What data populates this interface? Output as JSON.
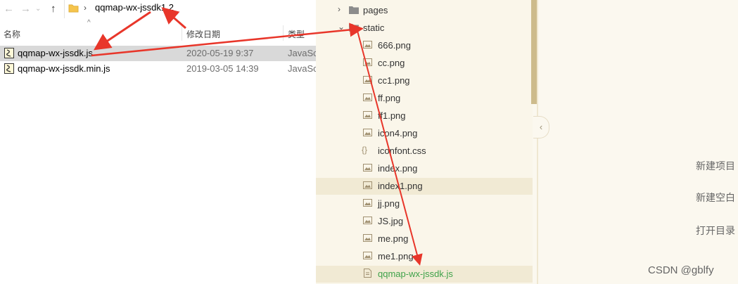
{
  "explorer": {
    "breadcrumb": "qqmap-wx-jssdk1.2",
    "columns": {
      "name": "名称",
      "date": "修改日期",
      "type": "类型"
    },
    "files": [
      {
        "name": "qqmap-wx-jssdk.js",
        "date": "2020-05-19 9:37",
        "type": "JavaScript"
      },
      {
        "name": "qqmap-wx-jssdk.min.js",
        "date": "2019-03-05 14:39",
        "type": "JavaScript"
      }
    ]
  },
  "ide": {
    "tree": [
      {
        "label": "pages",
        "kind": "folder-collapsed"
      },
      {
        "label": "static",
        "kind": "folder-open"
      },
      {
        "label": "666.png",
        "kind": "image"
      },
      {
        "label": "cc.png",
        "kind": "image"
      },
      {
        "label": "cc1.png",
        "kind": "image"
      },
      {
        "label": "ff.png",
        "kind": "image"
      },
      {
        "label": "ff1.png",
        "kind": "image"
      },
      {
        "label": "icon4.png",
        "kind": "image"
      },
      {
        "label": "iconfont.css",
        "kind": "css"
      },
      {
        "label": "index.png",
        "kind": "image"
      },
      {
        "label": "index1.png",
        "kind": "image"
      },
      {
        "label": "jj.png",
        "kind": "image"
      },
      {
        "label": "JS.jpg",
        "kind": "image"
      },
      {
        "label": "me.png",
        "kind": "image"
      },
      {
        "label": "me1.png",
        "kind": "image"
      },
      {
        "label": "qqmap-wx-jssdk.js",
        "kind": "js"
      }
    ],
    "welcome": [
      "新建项目",
      "新建空白",
      "打开目录"
    ]
  },
  "watermark": "CSDN @gblfy",
  "colors": {
    "arrow": "#e8362a",
    "tree_bg": "#faf6ea",
    "highlight": "#f1ead4",
    "new_file": "#3fa24a",
    "selected_row": "#d9d9d9"
  }
}
